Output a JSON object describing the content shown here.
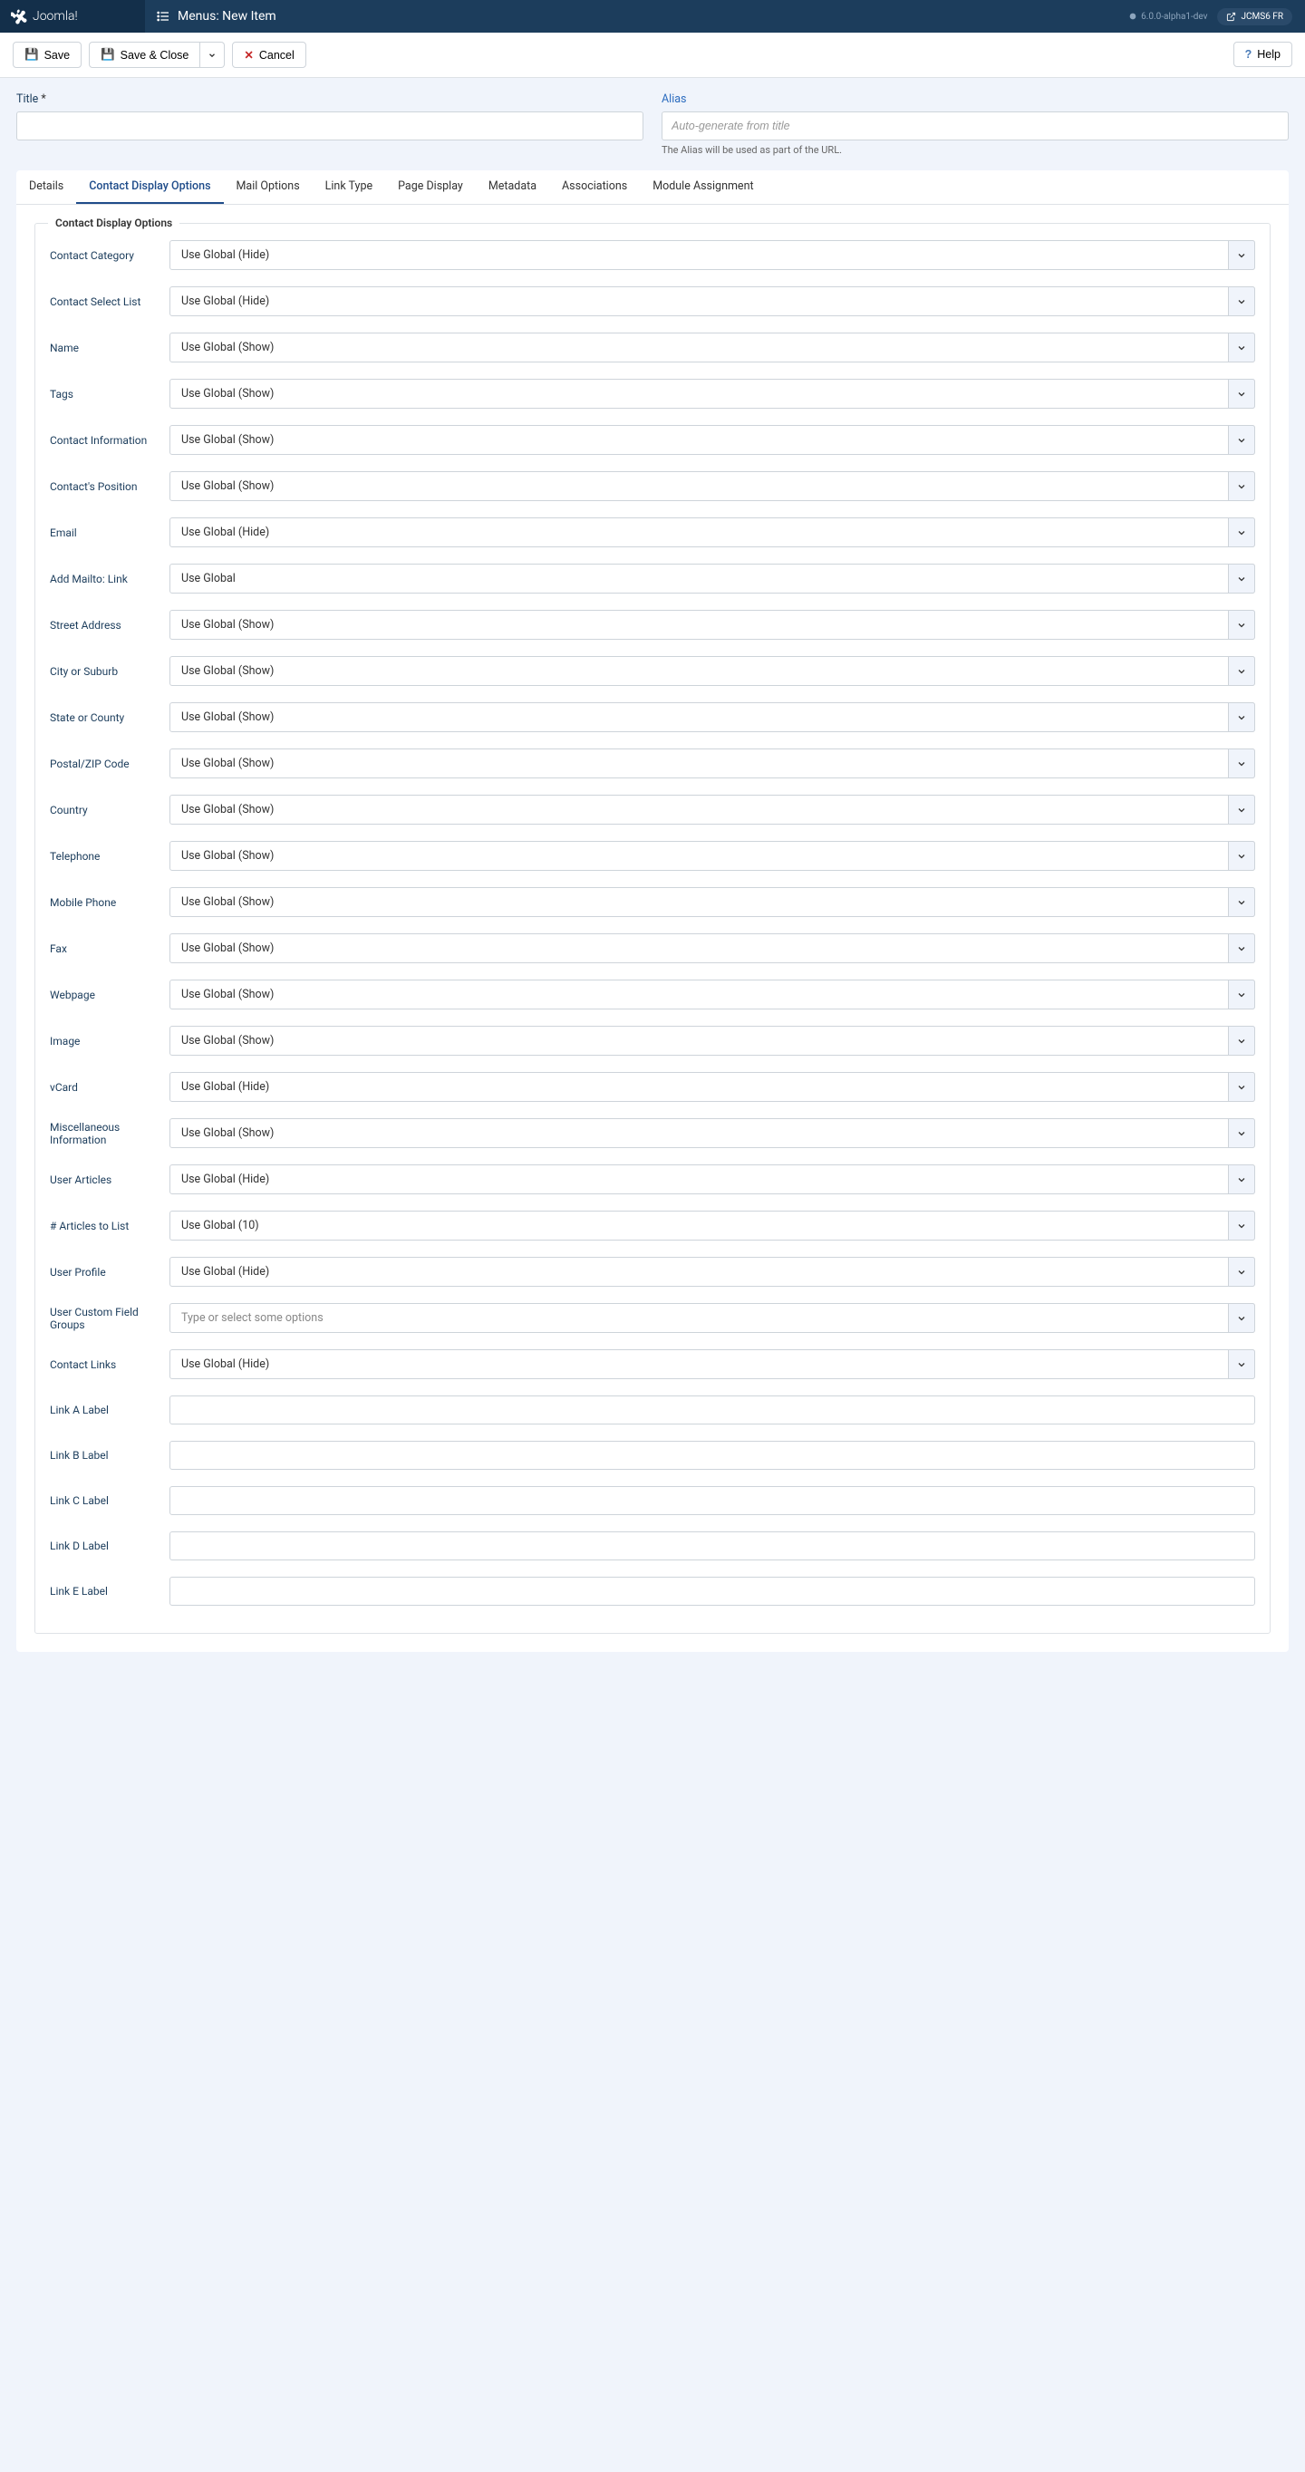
{
  "brand": "Joomla!",
  "page_title": "Menus: New Item",
  "version": "6.0.0-alpha1-dev",
  "user_menu": "JCMS6 FR",
  "toolbar": {
    "save": "Save",
    "save_close": "Save & Close",
    "cancel": "Cancel",
    "help": "Help"
  },
  "title_field": {
    "label": "Title",
    "required": "*"
  },
  "alias_field": {
    "label": "Alias",
    "placeholder": "Auto-generate from title",
    "hint": "The Alias will be used as part of the URL."
  },
  "tabs": [
    "Details",
    "Contact Display Options",
    "Mail Options",
    "Link Type",
    "Page Display",
    "Metadata",
    "Associations",
    "Module Assignment"
  ],
  "active_tab": "Contact Display Options",
  "fieldset_title": "Contact Display Options",
  "fields": [
    {
      "label": "Contact Category",
      "type": "select",
      "value": "Use Global (Hide)"
    },
    {
      "label": "Contact Select List",
      "type": "select",
      "value": "Use Global (Hide)"
    },
    {
      "label": "Name",
      "type": "select",
      "value": "Use Global (Show)"
    },
    {
      "label": "Tags",
      "type": "select",
      "value": "Use Global (Show)"
    },
    {
      "label": "Contact Information",
      "type": "select",
      "value": "Use Global (Show)"
    },
    {
      "label": "Contact's Position",
      "type": "select",
      "value": "Use Global (Show)"
    },
    {
      "label": "Email",
      "type": "select",
      "value": "Use Global (Hide)"
    },
    {
      "label": "Add Mailto: Link",
      "type": "select",
      "value": "Use Global"
    },
    {
      "label": "Street Address",
      "type": "select",
      "value": "Use Global (Show)"
    },
    {
      "label": "City or Suburb",
      "type": "select",
      "value": "Use Global (Show)"
    },
    {
      "label": "State or County",
      "type": "select",
      "value": "Use Global (Show)"
    },
    {
      "label": "Postal/ZIP Code",
      "type": "select",
      "value": "Use Global (Show)"
    },
    {
      "label": "Country",
      "type": "select",
      "value": "Use Global (Show)"
    },
    {
      "label": "Telephone",
      "type": "select",
      "value": "Use Global (Show)"
    },
    {
      "label": "Mobile Phone",
      "type": "select",
      "value": "Use Global (Show)"
    },
    {
      "label": "Fax",
      "type": "select",
      "value": "Use Global (Show)"
    },
    {
      "label": "Webpage",
      "type": "select",
      "value": "Use Global (Show)"
    },
    {
      "label": "Image",
      "type": "select",
      "value": "Use Global (Show)"
    },
    {
      "label": "vCard",
      "type": "select",
      "value": "Use Global (Hide)"
    },
    {
      "label": "Miscellaneous Information",
      "type": "select",
      "value": "Use Global (Show)"
    },
    {
      "label": "User Articles",
      "type": "select",
      "value": "Use Global (Hide)"
    },
    {
      "label": "# Articles to List",
      "type": "select",
      "value": "Use Global (10)"
    },
    {
      "label": "User Profile",
      "type": "select",
      "value": "Use Global (Hide)"
    },
    {
      "label": "User Custom Field Groups",
      "type": "multiselect",
      "value": "Type or select some options"
    },
    {
      "label": "Contact Links",
      "type": "select",
      "value": "Use Global (Hide)"
    },
    {
      "label": "Link A Label",
      "type": "text",
      "value": ""
    },
    {
      "label": "Link B Label",
      "type": "text",
      "value": ""
    },
    {
      "label": "Link C Label",
      "type": "text",
      "value": ""
    },
    {
      "label": "Link D Label",
      "type": "text",
      "value": ""
    },
    {
      "label": "Link E Label",
      "type": "text",
      "value": ""
    }
  ]
}
